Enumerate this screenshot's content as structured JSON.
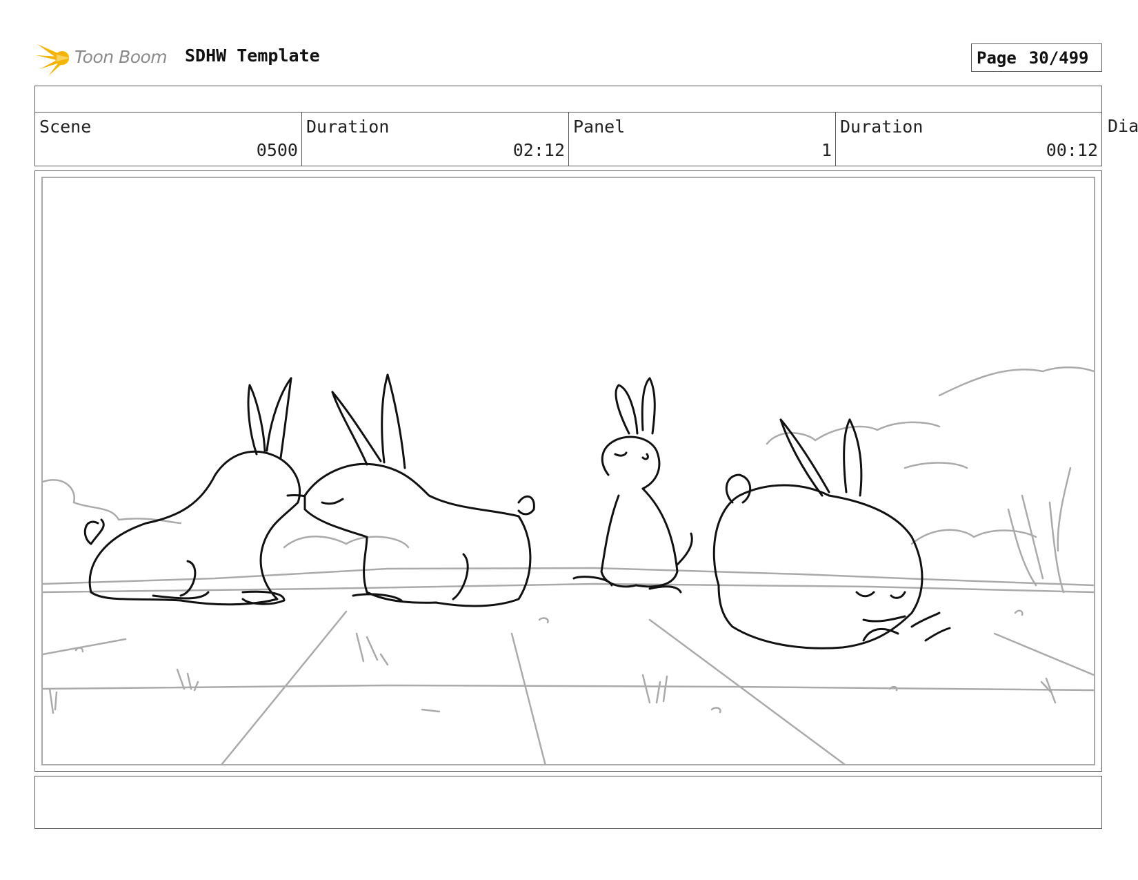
{
  "header": {
    "logo_text": "Toon Boom",
    "title": "SDHW Template",
    "page_label": "Page",
    "page_value": "30/499"
  },
  "info": {
    "scene_label": "Scene",
    "scene_value": "0500",
    "scene_duration_label": "Duration",
    "scene_duration_value": "02:12",
    "panel_label": "Panel",
    "panel_value": "1",
    "panel_duration_label": "Duration",
    "panel_duration_value": "00:12",
    "dialogue_label": "Dia"
  },
  "colors": {
    "logo_star": "#f4b400",
    "border": "#555555",
    "panel_frame": "#aaaaaa",
    "sketch_ink": "#111111",
    "background_sketch": "#aaaaaa"
  },
  "panel": {
    "drawing": "storyboard sketch"
  },
  "caption": {
    "text": ""
  }
}
